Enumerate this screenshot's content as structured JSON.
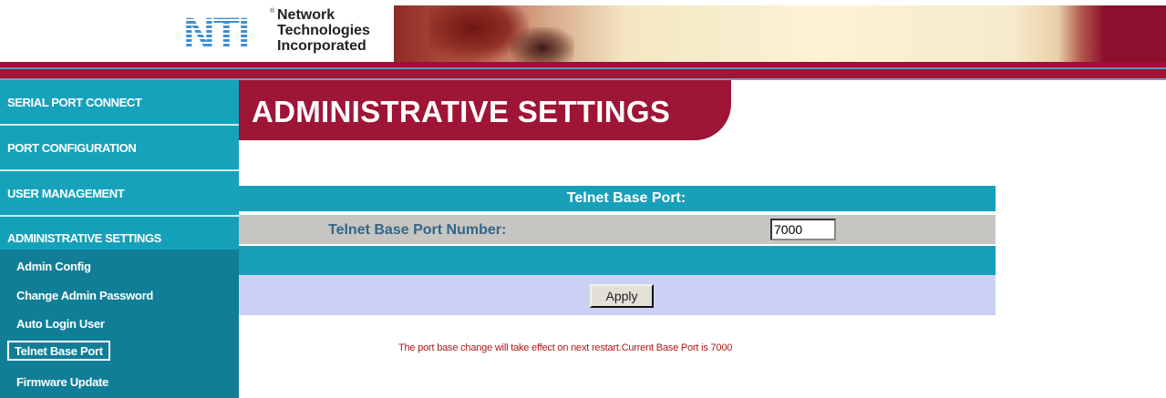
{
  "header": {
    "logo_letters": "NTI",
    "company_lines": [
      "Network",
      "Technologies",
      "Incorporated"
    ],
    "trademark": "®"
  },
  "sidebar": {
    "main_items": [
      {
        "label": "SERIAL PORT CONNECT"
      },
      {
        "label": "PORT CONFIGURATION"
      },
      {
        "label": "USER MANAGEMENT"
      },
      {
        "label": "ADMINISTRATIVE SETTINGS",
        "active": true
      }
    ],
    "sub_items": [
      {
        "label": "Admin Config"
      },
      {
        "label": "Change Admin Password"
      },
      {
        "label": "Auto Login User"
      },
      {
        "label": "Telnet Base Port",
        "selected": true
      },
      {
        "label": "Firmware Update"
      }
    ]
  },
  "main": {
    "title": "ADMINISTRATIVE SETTINGS",
    "panel_header": "Telnet Base Port:",
    "field_label": "Telnet Base Port Number:",
    "field_value": "7000",
    "apply_label": "Apply",
    "notice": "The port base change will take effect on next restart.Current Base Port is 7000"
  },
  "colors": {
    "accent_red": "#9e1536",
    "teal": "#16a0ba",
    "notice_red": "#b01818"
  }
}
